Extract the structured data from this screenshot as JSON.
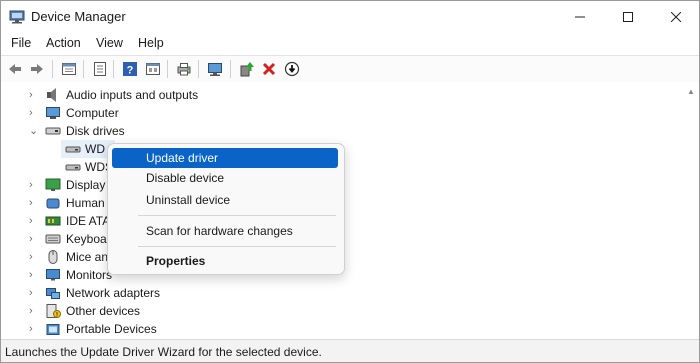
{
  "window": {
    "title": "Device Manager"
  },
  "menu": [
    "File",
    "Action",
    "View",
    "Help"
  ],
  "toolbar": {
    "buttons": [
      "back-icon",
      "forward-icon",
      "properties-sheet-icon",
      "update-list-icon",
      "help-icon",
      "view-icon",
      "print-icon",
      "computer-monitor-icon",
      "add-driver-icon",
      "uninstall-icon",
      "download-icon"
    ]
  },
  "tree": {
    "items": [
      {
        "label": "Audio inputs and outputs",
        "icon": "speaker-icon",
        "expanded": false
      },
      {
        "label": "Computer",
        "icon": "computer-icon",
        "expanded": false
      },
      {
        "label": "Disk drives",
        "icon": "disk-drive-icon",
        "expanded": true
      },
      {
        "label": "WD",
        "icon": "disk-icon",
        "child": true
      },
      {
        "label": "WDS",
        "icon": "disk-icon",
        "child": true
      },
      {
        "label": "Display",
        "icon": "display-icon",
        "expanded": false
      },
      {
        "label": "Human",
        "icon": "hid-icon",
        "expanded": false
      },
      {
        "label": "IDE ATA",
        "icon": "ide-icon",
        "expanded": false
      },
      {
        "label": "Keyboa",
        "icon": "keyboard-icon",
        "expanded": false
      },
      {
        "label": "Mice an",
        "icon": "mouse-icon",
        "expanded": false
      },
      {
        "label": "Monitors",
        "icon": "monitor-icon",
        "expanded": false
      },
      {
        "label": "Network adapters",
        "icon": "network-icon",
        "expanded": false
      },
      {
        "label": "Other devices",
        "icon": "other-devices-icon",
        "expanded": false
      },
      {
        "label": "Portable Devices",
        "icon": "portable-devices-icon",
        "expanded": false
      }
    ]
  },
  "context_menu": {
    "items": [
      "Update driver",
      "Disable device",
      "Uninstall device",
      "Scan for hardware changes",
      "Properties"
    ],
    "highlighted": "Update driver"
  },
  "status": {
    "text": "Launches the Update Driver Wizard for the selected device."
  },
  "colors": {
    "accent": "#0a64c8",
    "status_bg": "#f3f3f3"
  }
}
